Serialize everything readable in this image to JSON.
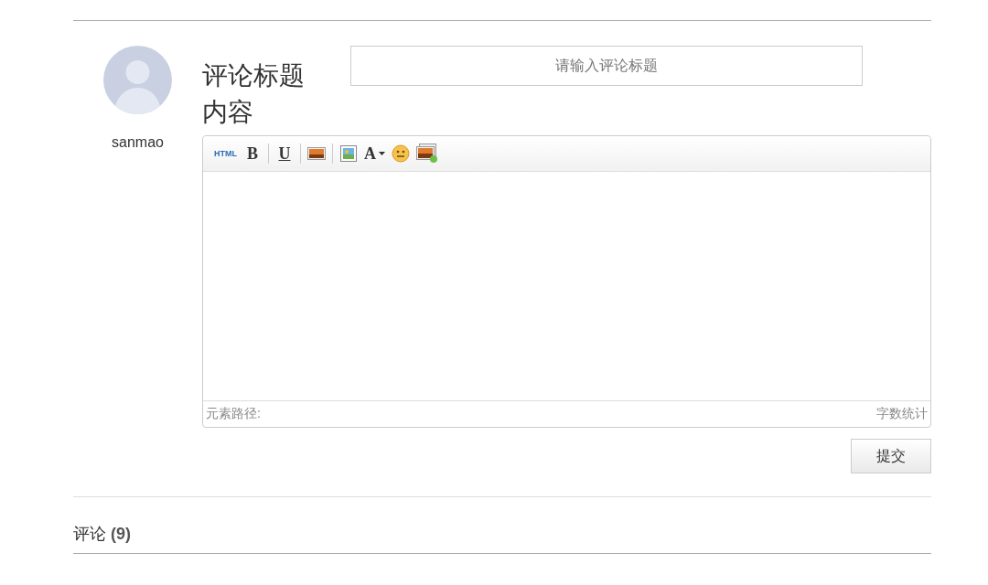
{
  "user": {
    "name": "sanmao"
  },
  "form": {
    "title_label": "评论标题",
    "title_field": {
      "placeholder": "请输入评论标题"
    },
    "content_label": "内容",
    "toolbar": {
      "groups": [
        [
          {
            "kind": "html",
            "text": "HTML"
          },
          {
            "kind": "bold",
            "text": "B"
          }
        ],
        [
          {
            "kind": "underline",
            "text": "U"
          }
        ],
        [
          {
            "kind": "image"
          }
        ],
        [
          {
            "kind": "picture"
          },
          {
            "kind": "font",
            "text": "A"
          },
          {
            "kind": "emoji"
          },
          {
            "kind": "gallery"
          }
        ]
      ]
    },
    "status": {
      "path_label": "元素路径:",
      "word_count": "字数统计"
    },
    "submit": "提交"
  },
  "comments": {
    "heading": "评论 **(9)**"
  }
}
